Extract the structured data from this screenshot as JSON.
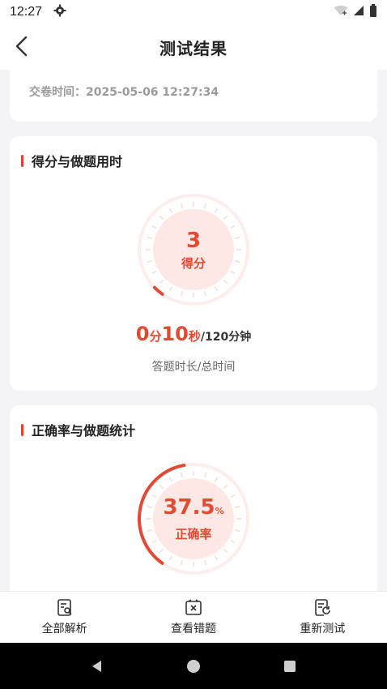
{
  "status_bar": {
    "time": "12:27"
  },
  "header": {
    "title": "测试结果"
  },
  "submit_info": {
    "text": "交卷时间：2025-05-06 12:27:34"
  },
  "score_section": {
    "title": "得分与做题用时",
    "score_value": "3",
    "score_label": "得分",
    "score_progress": 0.03,
    "duration_minutes": "0",
    "duration_minutes_unit": "分",
    "duration_seconds": "10",
    "duration_seconds_unit": "秒",
    "total_time": "/120分钟",
    "duration_label": "答题时长/总时间"
  },
  "accuracy_section": {
    "title": "正确率与做题统计",
    "accuracy_value": "37.5",
    "accuracy_unit": "%",
    "accuracy_label": "正确率",
    "accuracy_progress": 0.375
  },
  "bottom_tabs": [
    {
      "label": "全部解析",
      "icon": "analysis-icon"
    },
    {
      "label": "查看错题",
      "icon": "wrong-questions-icon"
    },
    {
      "label": "重新测试",
      "icon": "retest-icon"
    }
  ],
  "colors": {
    "accent": "#e24a33",
    "ring_light": "#fde8e6"
  }
}
